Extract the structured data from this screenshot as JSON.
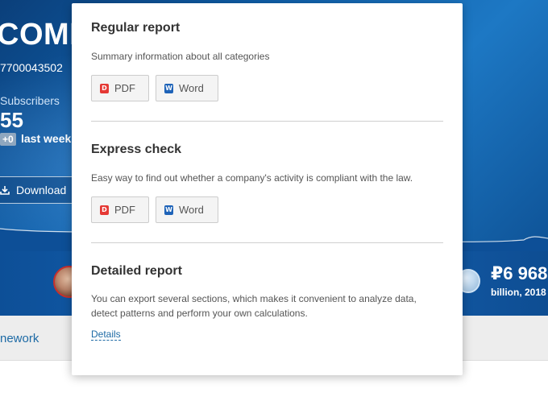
{
  "hero": {
    "company_title": "COMP",
    "ogrn": "7700043502",
    "subscribers_label": "Subscribers",
    "subscribers_count": "55",
    "delta_badge": "+0",
    "delta_text": "last week",
    "download_label": "Download",
    "revenue": "₽6 968",
    "revenue_sub": "billion, 2018"
  },
  "tabs": {
    "framework": "nework"
  },
  "panel": {
    "regular": {
      "title": "Regular report",
      "description": "Summary information about all categories",
      "pdf": "PDF",
      "word": "Word"
    },
    "express": {
      "title": "Express check",
      "description": "Easy way to find out whether a company's activity is compliant with the law.",
      "pdf": "PDF",
      "word": "Word"
    },
    "detailed": {
      "title": "Detailed report",
      "description": "You can export several sections, which makes it convenient to analyze data, detect patterns and perform your own calculations.",
      "details_link": "Details"
    }
  },
  "icons": {
    "pdf": "pdf-icon",
    "word": "word-icon",
    "download": "download-icon"
  },
  "colors": {
    "accent_link": "#1d6aa5",
    "pdf_red": "#e53935",
    "word_blue": "#1e63b8",
    "hero_blue": "#0f5ea8"
  }
}
